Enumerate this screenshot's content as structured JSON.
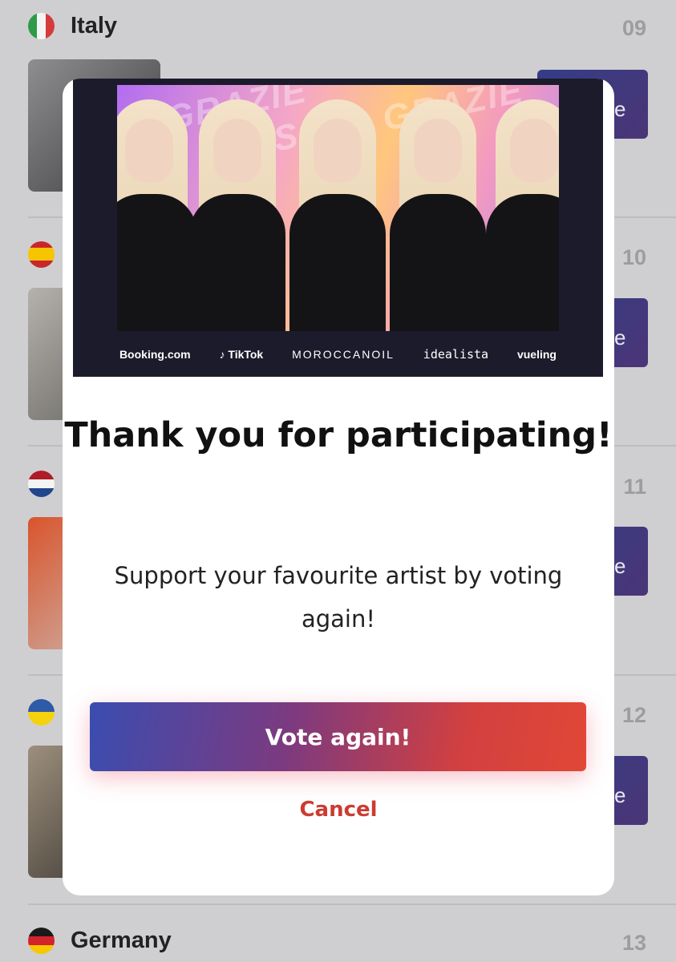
{
  "list": {
    "rows": [
      {
        "country": "Italy",
        "number": "09"
      },
      {
        "country": "",
        "number": "10"
      },
      {
        "country": "",
        "number": "11"
      },
      {
        "country": "",
        "number": "12"
      },
      {
        "country": "Germany",
        "number": "13"
      }
    ],
    "vote_tile_label": "e"
  },
  "modal": {
    "banner": {
      "sponsors": [
        "Booking.com",
        "♪ TikTok",
        "MOROCCANOIL",
        "idealista",
        "vueling"
      ],
      "art_text": [
        "GRAZIE",
        "X S10",
        "GRAZIE"
      ]
    },
    "title": "Thank you for participating!",
    "subtitle": "Support your favourite artist by voting again!",
    "vote_again_label": "Vote again!",
    "cancel_label": "Cancel"
  },
  "colors": {
    "accent_red": "#cc3b31",
    "gradient_start": "#3a4db0",
    "gradient_end": "#e14737"
  }
}
